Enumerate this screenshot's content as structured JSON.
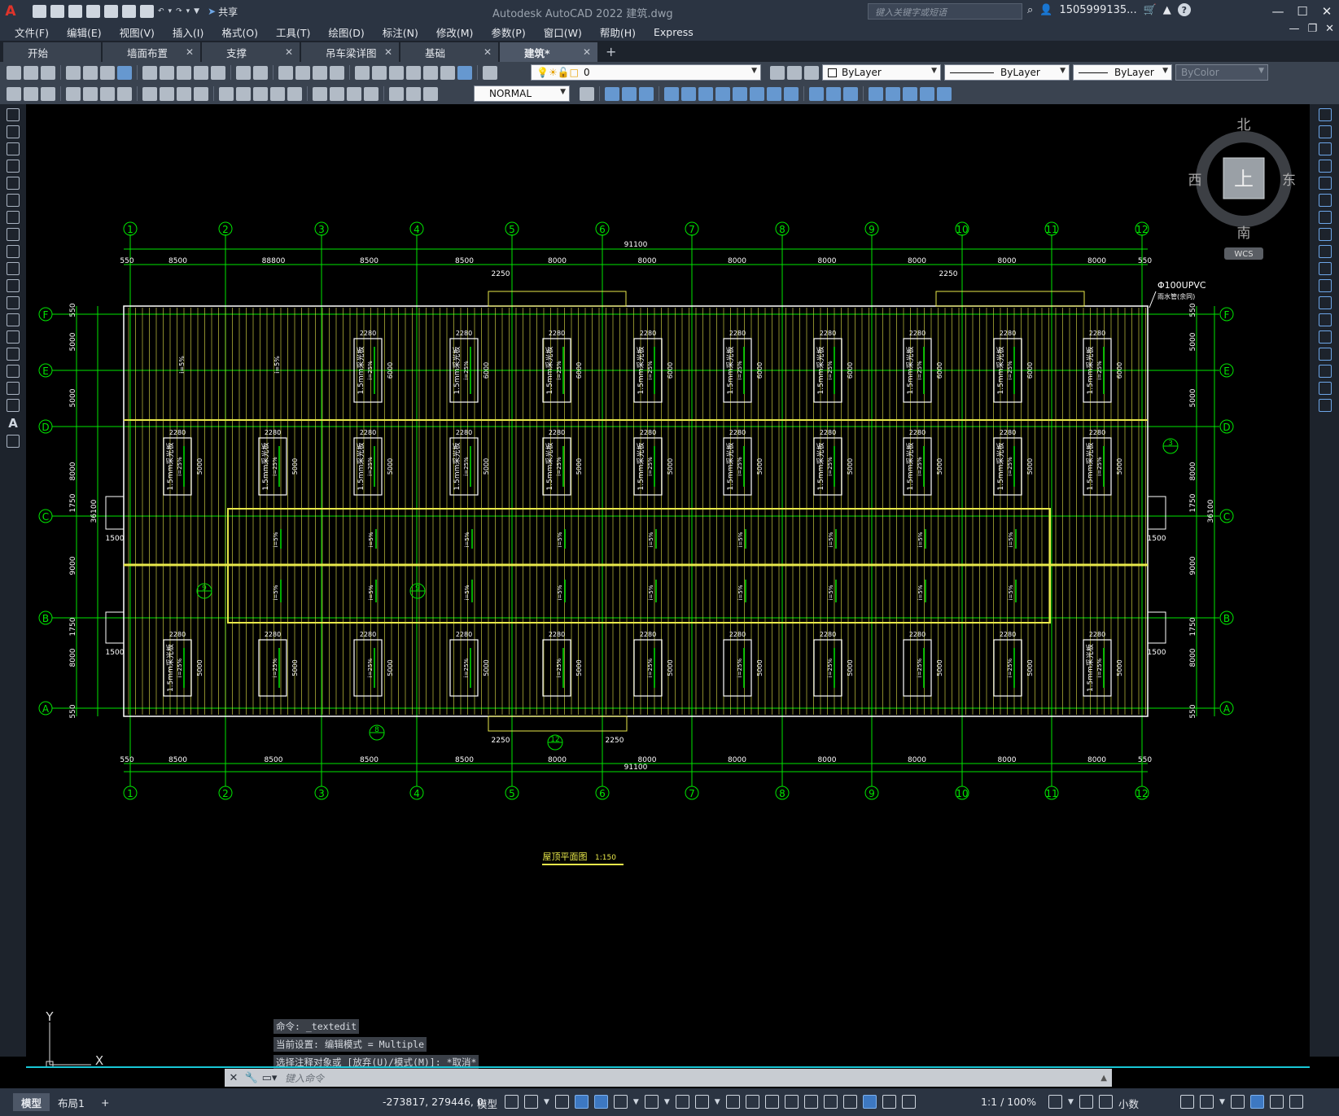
{
  "app": {
    "title": "Autodesk AutoCAD 2022    建筑.dwg",
    "icon_letter": "A",
    "share_label": "共享",
    "search_placeholder": "键入关键字或短语",
    "user": "1505999135...",
    "window_buttons": [
      "—",
      "☐",
      "✕"
    ]
  },
  "menu": [
    "文件(F)",
    "编辑(E)",
    "视图(V)",
    "插入(I)",
    "格式(O)",
    "工具(T)",
    "绘图(D)",
    "标注(N)",
    "修改(M)",
    "参数(P)",
    "窗口(W)",
    "帮助(H)",
    "Express"
  ],
  "tabs": [
    {
      "label": "开始",
      "active": false
    },
    {
      "label": "墙面布置",
      "active": false
    },
    {
      "label": "支撑",
      "active": false
    },
    {
      "label": "吊车梁详图",
      "active": false
    },
    {
      "label": "基础",
      "active": false
    },
    {
      "label": "建筑*",
      "active": true
    }
  ],
  "properties": {
    "layer": "0",
    "color": "ByLayer",
    "linetype": "ByLayer",
    "lineweight": "ByLayer",
    "plotstyle": "ByColor",
    "dimstyle": "NORMAL"
  },
  "viewcube": {
    "north": "北",
    "south": "南",
    "east": "东",
    "west": "西",
    "top": "上",
    "wcs": "WCS"
  },
  "drawing": {
    "grid_columns": [
      "1",
      "2",
      "3",
      "4",
      "5",
      "6",
      "7",
      "8",
      "9",
      "10",
      "11",
      "12"
    ],
    "grid_rows": [
      "F",
      "E",
      "D",
      "C",
      "B",
      "A"
    ],
    "overall_dim": "91100",
    "bay_dims": [
      "550",
      "8500",
      "8500",
      "8500",
      "8500",
      "8000",
      "8000",
      "8000",
      "8000",
      "8000",
      "8000",
      "8000",
      "550"
    ],
    "top_first_bay_label": "88800",
    "left_dims": [
      "550",
      "5000",
      "5000",
      "8000",
      "1750",
      "9000",
      "1750",
      "8000",
      "550"
    ],
    "total_depth": "36100",
    "ridge_dim": "2250",
    "drain_pipe": "Φ100UPVC",
    "drain_pipe_note": "雨水管(余同)",
    "skylight_width": "2280",
    "skylight_length_upper": "6000",
    "skylight_length": "5000",
    "skylight_note": "1.5mm采光板",
    "slope": "i=25%",
    "slope_low": "i=5%",
    "side_dim": "1500",
    "section_marks": [
      "3",
      "9",
      "9",
      "8",
      "12"
    ],
    "drawing_title": "屋顶平面图",
    "scale": "1:150"
  },
  "ucs": {
    "x": "X",
    "y": "Y"
  },
  "command_history": [
    "命令: _textedit",
    "当前设置: 编辑模式 = Multiple",
    "选择注释对象或 [放弃(U)/模式(M)]: *取消*"
  ],
  "command_placeholder": "键入命令",
  "status": {
    "model_tab": "模型",
    "layout_tab": "布局1",
    "add": "+",
    "coords": "-273817, 279446, 0",
    "space": "模型",
    "annotation_scale": "1:1 / 100%",
    "units": "小数"
  },
  "colors": {
    "grid": "#00e600",
    "outline": "#e8e84a",
    "text_white": "#ffffff",
    "accent_cyan": "#18c7d6",
    "chrome": "#2b3442"
  }
}
